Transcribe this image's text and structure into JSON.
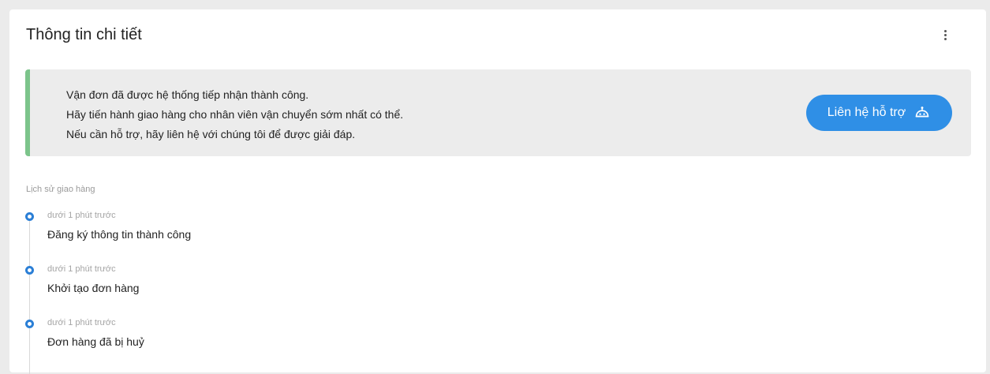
{
  "card": {
    "title": "Thông tin chi tiết"
  },
  "notice": {
    "lines": [
      "Vận đơn đã được hệ thống tiếp nhận thành công.",
      "Hãy tiến hành giao hàng cho nhân viên vận chuyển sớm nhất có thể.",
      "Nếu cần hỗ trợ, hãy liên hệ với chúng tôi để được giải đáp."
    ],
    "support_button_label": "Liên hệ hỗ trợ",
    "support_icon": "robot-icon",
    "accent_color": "#7cc48b",
    "button_color": "#2f8fe6"
  },
  "history": {
    "label": "Lịch sử giao hàng",
    "items": [
      {
        "time": "dưới 1 phút trước",
        "text": "Đăng ký thông tin thành công"
      },
      {
        "time": "dưới 1 phút trước",
        "text": "Khởi tạo đơn hàng"
      },
      {
        "time": "dưới 1 phút trước",
        "text": "Đơn hàng đã bị huỷ"
      }
    ]
  },
  "menu_icon": "more-vertical-icon"
}
